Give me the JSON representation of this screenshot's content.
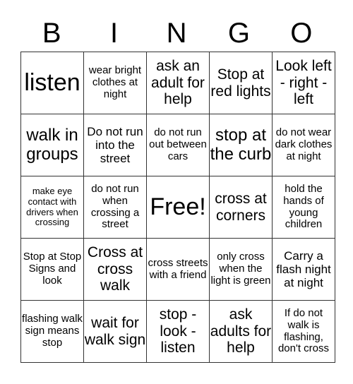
{
  "header": {
    "letters": [
      "B",
      "I",
      "N",
      "G",
      "O"
    ]
  },
  "grid": [
    [
      "listen",
      "wear bright clothes at night",
      "ask an adult for help",
      "Stop at red lights",
      "Look left - right - left"
    ],
    [
      "walk in groups",
      "Do not run into the street",
      "do not run out between cars",
      "stop at the curb",
      "do not wear dark clothes at night"
    ],
    [
      "make eye contact with drivers when crossing",
      "do not run when crossing a street",
      "Free!",
      "cross at corners",
      "hold the hands of young children"
    ],
    [
      "Stop at Stop Signs and look",
      "Cross at cross walk",
      "cross streets with a friend",
      "only cross when the light is green",
      "Carry a flash night at night"
    ],
    [
      "flashing walk sign means stop",
      "wait for walk sign",
      "stop - look - listen",
      "ask adults for help",
      "If do not walk is flashing, don't cross"
    ]
  ]
}
